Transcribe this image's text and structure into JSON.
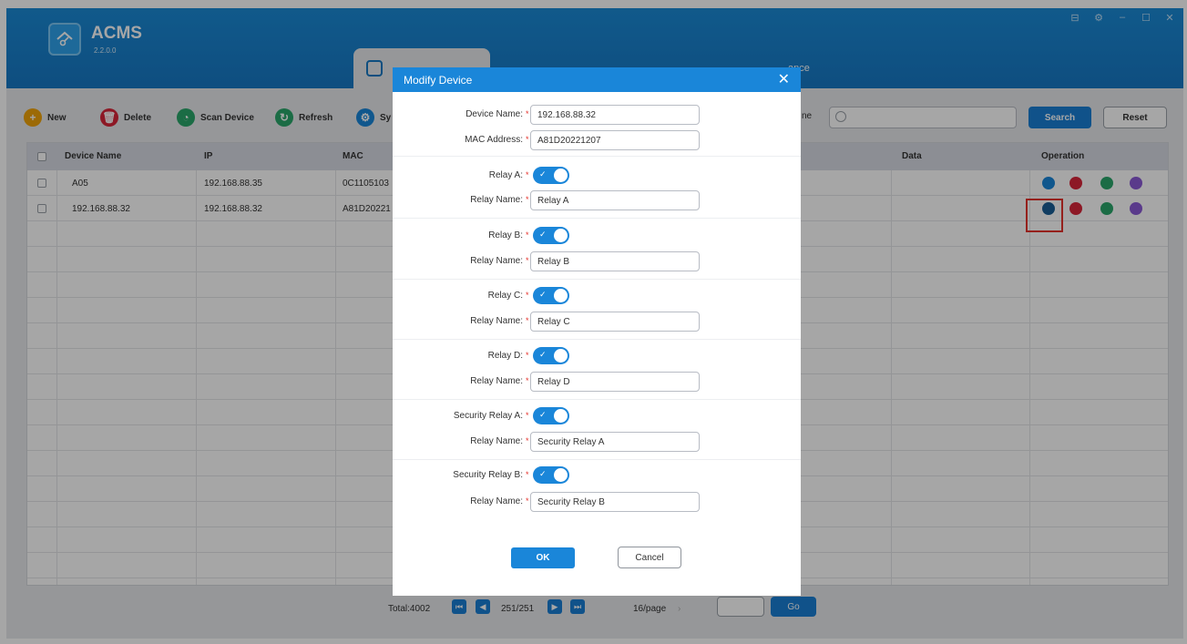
{
  "app": {
    "title": "ACMS",
    "version": "2.2.0.0"
  },
  "window_controls": [
    "⊟",
    "⚙",
    "–",
    "☐",
    "✕"
  ],
  "tabs": {
    "partial_label": "ance"
  },
  "toolbar": {
    "new_label": "New",
    "delete_label": "Delete",
    "scan_label": "Scan Device",
    "refresh_label": "Refresh",
    "sync_label": "Sy",
    "name_label_partial": "ne",
    "search_label": "Search",
    "reset_label": "Reset"
  },
  "colors": {
    "primary": "#1a86d9",
    "delete": "#d9263a",
    "scan": "#2aa66a",
    "refresh": "#2aa66a",
    "sync": "#1a86d9",
    "new": "#f0a30a",
    "purple": "#8a5ad6",
    "highlight": "#e5322b"
  },
  "table": {
    "headers": {
      "device_name": "Device Name",
      "ip": "IP",
      "mac": "MAC",
      "data": "Data",
      "operation": "Operation"
    },
    "rows": [
      {
        "device_name": "A05",
        "ip": "192.168.88.35",
        "mac": "0C1105103"
      },
      {
        "device_name": "192.168.88.32",
        "ip": "192.168.88.32",
        "mac": "A81D20221"
      }
    ],
    "operation_icons": [
      "edit-icon",
      "delete-icon",
      "transfer-icon",
      "link-icon"
    ]
  },
  "pagination": {
    "total": "Total:4002",
    "page": "251/251",
    "per_page": "16/page",
    "per_page_arrow": "›",
    "go_label": "Go"
  },
  "modal": {
    "title": "Modify Device",
    "close": "✕",
    "device_name_label": "Device Name:",
    "device_name_value": "192.168.88.32",
    "mac_label": "MAC Address:",
    "mac_value": "A81D20221207",
    "relay_name_label": "Relay Name:",
    "required_mark": "*",
    "relays": [
      {
        "label": "Relay A:",
        "name": "Relay A",
        "enabled": true
      },
      {
        "label": "Relay B:",
        "name": "Relay B",
        "enabled": true
      },
      {
        "label": "Relay C:",
        "name": "Relay C",
        "enabled": true
      },
      {
        "label": "Relay D:",
        "name": "Relay D",
        "enabled": true
      },
      {
        "label": "Security Relay A:",
        "name": "Security Relay A",
        "enabled": true
      },
      {
        "label": "Security Relay B:",
        "name": "Security Relay B",
        "enabled": true
      }
    ],
    "ok_label": "OK",
    "cancel_label": "Cancel"
  }
}
